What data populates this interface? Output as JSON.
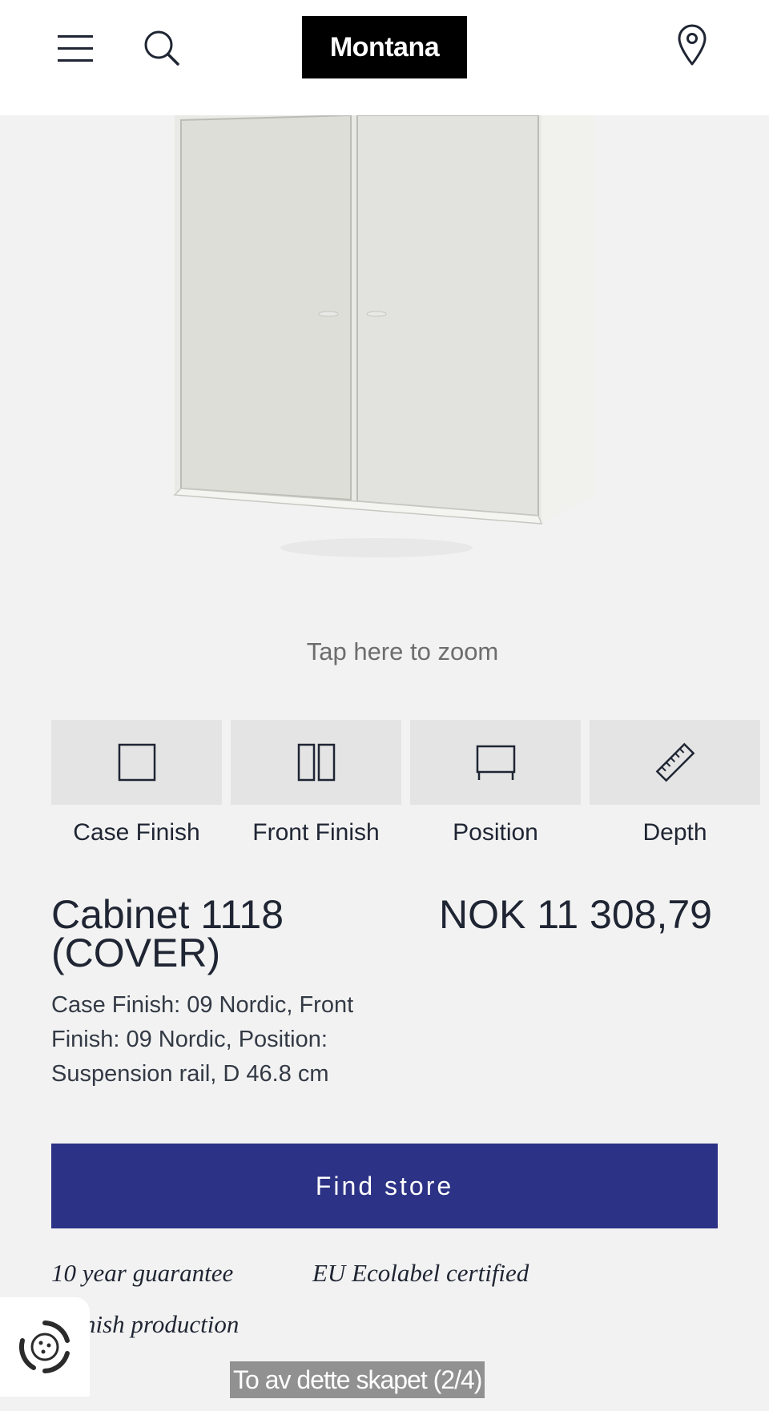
{
  "header": {
    "logo_text": "Montana",
    "menu_icon": "hamburger-menu-icon",
    "search_icon": "search-icon",
    "location_icon": "map-pin-icon"
  },
  "product_image": {
    "zoom_hint": "Tap here to zoom"
  },
  "options": [
    {
      "label": "Case Finish",
      "icon": "square-outline-icon"
    },
    {
      "label": "Front Finish",
      "icon": "double-panel-icon"
    },
    {
      "label": "Position",
      "icon": "suspension-rail-icon"
    },
    {
      "label": "Depth",
      "icon": "ruler-icon"
    }
  ],
  "product": {
    "title": "Cabinet 1118 (COVER)",
    "price": "NOK 11 308,79",
    "description": "Case Finish: 09 Nordic, Front Finish: 09 Nordic, Position: Suspension rail, D 46.8 cm"
  },
  "cta": {
    "find_store_label": "Find store"
  },
  "features": {
    "guarantee": "10 year guarantee",
    "ecolabel": "EU Ecolabel certified",
    "production": "nish production"
  },
  "caption": {
    "text": "To av dette skapet (2/4)"
  },
  "colors": {
    "accent": "#2c3285",
    "background": "#f2f2f2",
    "tile": "#e4e4e4",
    "text": "#1f2533"
  }
}
